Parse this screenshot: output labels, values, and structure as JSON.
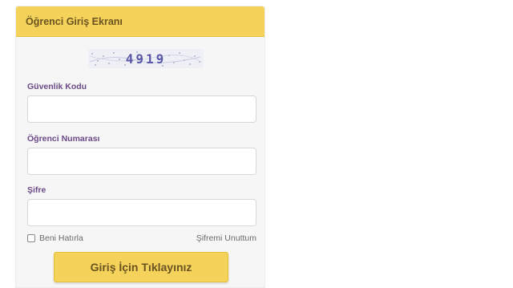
{
  "header": {
    "title": "Öğrenci Giriş Ekranı"
  },
  "captcha": {
    "code": "4919"
  },
  "fields": {
    "security_code_label": "Güvenlik Kodu",
    "security_code_value": "",
    "student_number_label": "Öğrenci Numarası",
    "student_number_value": "",
    "password_label": "Şifre",
    "password_value": ""
  },
  "options": {
    "remember_label": "Beni Hatırla",
    "remember_checked": false,
    "forgot_label": "Şifremi Unuttum"
  },
  "actions": {
    "login_label": "Giriş İçin Tıklayınız"
  },
  "colors": {
    "accent": "#f5d35b",
    "label_text": "#6b4a86",
    "header_text": "#6a5320"
  }
}
